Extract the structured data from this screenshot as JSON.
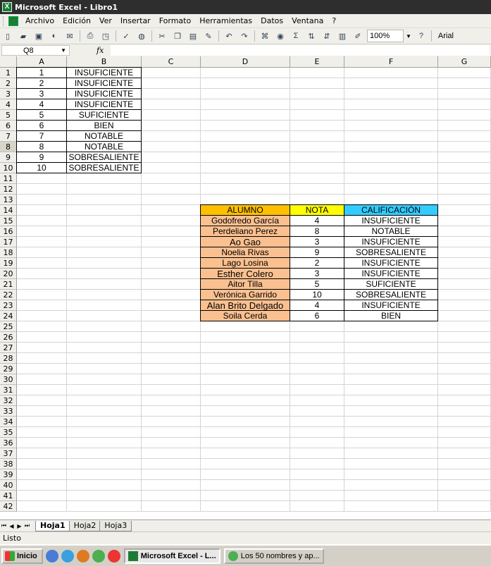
{
  "window": {
    "title": "Microsoft Excel - Libro1"
  },
  "menu": [
    "Archivo",
    "Edición",
    "Ver",
    "Insertar",
    "Formato",
    "Herramientas",
    "Datos",
    "Ventana",
    "?"
  ],
  "toolbar": {
    "zoom": "100%",
    "font": "Arial",
    "sigma": "Σ"
  },
  "formula": {
    "namebox": "Q8",
    "fx": "fx",
    "content": ""
  },
  "columns": [
    "A",
    "B",
    "C",
    "D",
    "E",
    "F",
    "G"
  ],
  "rows_visible": 42,
  "selected_row": 8,
  "table1": [
    {
      "n": "1",
      "label": "INSUFICIENTE"
    },
    {
      "n": "2",
      "label": "INSUFICIENTE"
    },
    {
      "n": "3",
      "label": "INSUFICIENTE"
    },
    {
      "n": "4",
      "label": "INSUFICIENTE"
    },
    {
      "n": "5",
      "label": "SUFICIENTE"
    },
    {
      "n": "6",
      "label": "BIEN"
    },
    {
      "n": "7",
      "label": "NOTABLE"
    },
    {
      "n": "8",
      "label": "NOTABLE"
    },
    {
      "n": "9",
      "label": "SOBRESALIENTE"
    },
    {
      "n": "10",
      "label": "SOBRESALIENTE"
    }
  ],
  "table2": {
    "headers": {
      "alumno": "ALUMNO",
      "nota": "NOTA",
      "calificacion": "CALIFICACIÓN"
    },
    "rows": [
      {
        "alumno": "Godofredo García",
        "nota": "4",
        "calificacion": "INSUFICIENTE"
      },
      {
        "alumno": "Perdeliano Perez",
        "nota": "8",
        "calificacion": "NOTABLE"
      },
      {
        "alumno": "Ao Gao",
        "nota": "3",
        "calificacion": "INSUFICIENTE"
      },
      {
        "alumno": "Noelia Rivas",
        "nota": "9",
        "calificacion": "SOBRESALIENTE"
      },
      {
        "alumno": "Lago Losina",
        "nota": "2",
        "calificacion": "INSUFICIENTE"
      },
      {
        "alumno": "Esther Colero",
        "nota": "3",
        "calificacion": "INSUFICIENTE"
      },
      {
        "alumno": "Aitor Tilla",
        "nota": "5",
        "calificacion": "SUFICIENTE"
      },
      {
        "alumno": "Verónica Garrido",
        "nota": "10",
        "calificacion": "SOBRESALIENTE"
      },
      {
        "alumno": "Alan Brito Delgado",
        "nota": "4",
        "calificacion": "INSUFICIENTE"
      },
      {
        "alumno": "Soila Cerda",
        "nota": "6",
        "calificacion": "BIEN"
      }
    ]
  },
  "sheets": [
    "Hoja1",
    "Hoja2",
    "Hoja3"
  ],
  "active_sheet": "Hoja1",
  "status": "Listo",
  "taskbar": {
    "start": "Inicio",
    "buttons": [
      "Microsoft Excel - L...",
      "Los 50 nombres y ap..."
    ]
  },
  "colors": {
    "orange": "#ffc000",
    "yellow": "#ffff00",
    "cyan": "#33ccff",
    "peach": "#fac090"
  }
}
